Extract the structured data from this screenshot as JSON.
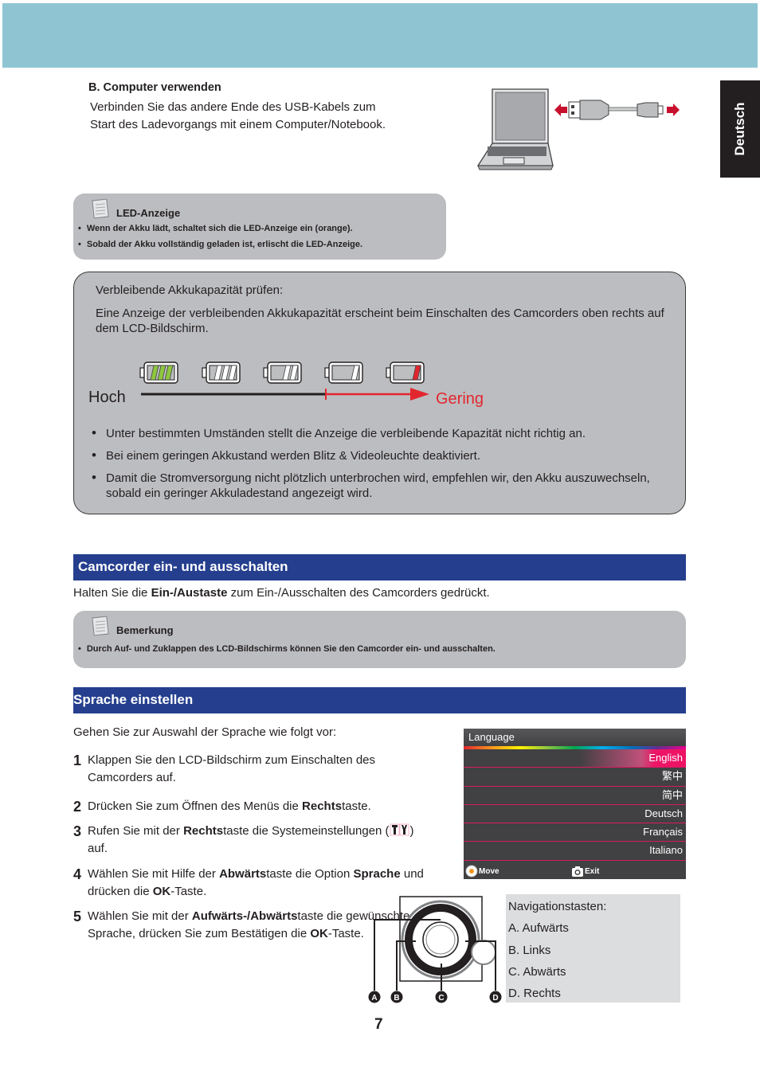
{
  "side_tab": {
    "label": "Deutsch"
  },
  "usb_section": {
    "title": "B. Computer verwenden",
    "lines": [
      "Verbinden Sie das andere Ende des USB-Kabels zum",
      "Start des Ladevorgangs mit einem Computer/Notebook."
    ],
    "illustration": "laptop-usb-cable-illustration"
  },
  "led_note": {
    "title": "LED-Anzeige",
    "bullets": [
      "Wenn der Akku lädt, schaltet sich die LED-Anzeige ein (orange).",
      "Sobald der Akku vollständig geladen ist, erlischt die LED-Anzeige."
    ]
  },
  "battery_box": {
    "heading": "Verbleibende Akkukapazität prüfen:",
    "paragraph": "Eine Anzeige der verbleibenden Akkukapazität erscheint beim Einschalten des Camcorders oben rechts auf dem LCD-Bildschirm.",
    "levels": [
      {
        "name": "full",
        "bars": 3,
        "color": "#8dc63f"
      },
      {
        "name": "high",
        "bars": 3,
        "color": "#ffffff"
      },
      {
        "name": "medium",
        "bars": 2,
        "color": "#ffffff"
      },
      {
        "name": "low",
        "bars": 1,
        "color": "#ffffff"
      },
      {
        "name": "empty",
        "bars": 1,
        "color": "#e3262e"
      }
    ],
    "scale_high_label": "Hoch",
    "scale_low_label": "Gering",
    "scale_low_color": "#e3262e",
    "bullets": [
      "Unter bestimmten Umständen stellt die Anzeige die verbleibende Kapazität nicht richtig an.",
      "Bei einem geringen Akkustand werden Blitz & Videoleuchte deaktiviert.",
      "Damit die Stromversorgung nicht plötzlich unterbrochen wird, empfehlen wir, den Akku auszuwechseln, sobald ein geringer Akkuladestand angezeigt wird."
    ]
  },
  "power_section": {
    "title": "Camcorder ein- und ausschalten",
    "text_before": "Halten Sie die ",
    "text_bold": "Ein-/Austaste",
    "text_after": " zum Ein-/Ausschalten des Camcorders gedrückt."
  },
  "remark_note": {
    "title": "Bemerkung",
    "bullets": [
      "Durch Auf- und Zuklappen des LCD-Bildschirms können Sie den Camcorder ein- und ausschalten."
    ]
  },
  "language_section": {
    "title": "Sprache einstellen",
    "intro": "Gehen Sie zur Auswahl der Sprache wie folgt vor:",
    "steps": [
      {
        "num": "1",
        "parts": [
          [
            "Klappen Sie den LCD-Bildschirm zum Einschalten des Camcorders auf.",
            false
          ]
        ]
      },
      {
        "num": "2",
        "parts": [
          [
            "Drücken Sie zum Öffnen des Menüs die ",
            false
          ],
          [
            "Rechts",
            true
          ],
          [
            "taste.",
            false
          ]
        ]
      },
      {
        "num": "3",
        "parts": [
          [
            "Rufen Sie mit der ",
            false
          ],
          [
            "Rechts",
            true
          ],
          [
            "taste die Systemeinstellungen (",
            false
          ],
          [
            "{tool}",
            false
          ],
          [
            ") auf.",
            false
          ]
        ]
      },
      {
        "num": "4",
        "parts": [
          [
            "Wählen Sie mit Hilfe der ",
            false
          ],
          [
            "Abwärts",
            true
          ],
          [
            "taste die Option ",
            false
          ],
          [
            "Sprache",
            true
          ],
          [
            " und drücken die ",
            false
          ],
          [
            "OK",
            true
          ],
          [
            "-Taste.",
            false
          ]
        ]
      },
      {
        "num": "5",
        "parts": [
          [
            "Wählen Sie mit der ",
            false
          ],
          [
            "Aufwärts-/Abwärts",
            true
          ],
          [
            "taste die gewünschte Sprache, drücken Sie zum Bestätigen die ",
            false
          ],
          [
            "OK",
            true
          ],
          [
            "-Taste.",
            false
          ]
        ]
      }
    ]
  },
  "lcd_menu": {
    "title": "Language",
    "items": [
      "English",
      "繁中",
      "简中",
      "Deutsch",
      "Français",
      "Italiano"
    ],
    "selected": "English",
    "footer_move": "Move",
    "footer_exit": "Exit",
    "accent_color": "#ed1466"
  },
  "nav_keys": {
    "title": "Navigationstasten:",
    "items": [
      "A. Aufwärts",
      "B. Links",
      "C. Abwärts",
      "D. Rechts"
    ],
    "markers": [
      "A",
      "B",
      "C",
      "D"
    ]
  },
  "page_number": "7"
}
